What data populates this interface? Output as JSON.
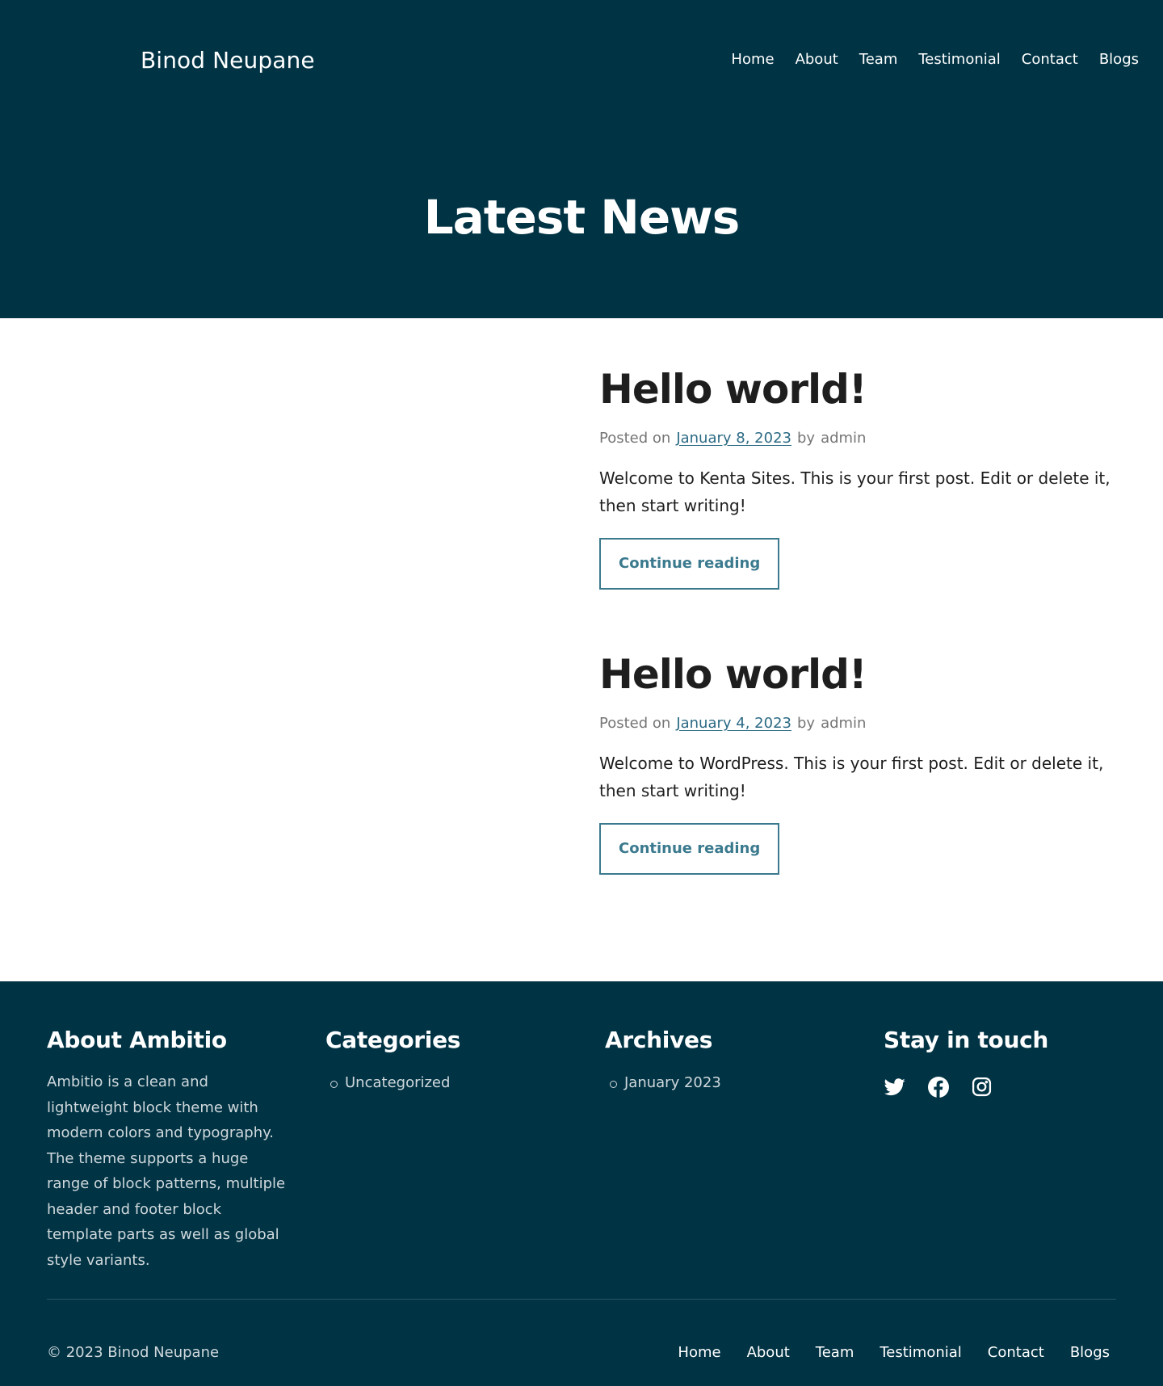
{
  "header": {
    "site_title": "Binod Neupane",
    "nav": [
      "Home",
      "About",
      "Team",
      "Testimonial",
      "Contact",
      "Blogs"
    ]
  },
  "hero": {
    "title": "Latest News"
  },
  "posts": [
    {
      "title": "Hello world!",
      "posted_on_label": "Posted on",
      "date": "January 8, 2023",
      "by_label": "by",
      "author": "admin",
      "excerpt": "Welcome to Kenta Sites. This is your first post. Edit or delete it, then start writing!",
      "button_label": "Continue reading"
    },
    {
      "title": "Hello world!",
      "posted_on_label": "Posted on",
      "date": "January 4, 2023",
      "by_label": "by",
      "author": "admin",
      "excerpt": "Welcome to WordPress. This is your first post. Edit or delete it, then start writing!",
      "button_label": "Continue reading"
    }
  ],
  "footer": {
    "about": {
      "heading": "About Ambitio",
      "text": "Ambitio is a clean and lightweight block theme with modern colors and typography. The theme supports a huge range of block patterns, multiple header and footer block template parts as well as global style variants."
    },
    "categories": {
      "heading": "Categories",
      "items": [
        "Uncategorized"
      ]
    },
    "archives": {
      "heading": "Archives",
      "items": [
        "January 2023"
      ]
    },
    "stay_in_touch": {
      "heading": "Stay in touch",
      "icons": [
        "twitter-icon",
        "facebook-icon",
        "instagram-icon"
      ]
    },
    "copyright": "© 2023 Binod Neupane",
    "nav": [
      "Home",
      "About",
      "Team",
      "Testimonial",
      "Contact",
      "Blogs"
    ]
  },
  "colors": {
    "header_bg": "#003344",
    "footer_bg": "#003344",
    "accent": "#3b7a8e",
    "link": "#2b6a84",
    "meta_text": "#757575"
  }
}
